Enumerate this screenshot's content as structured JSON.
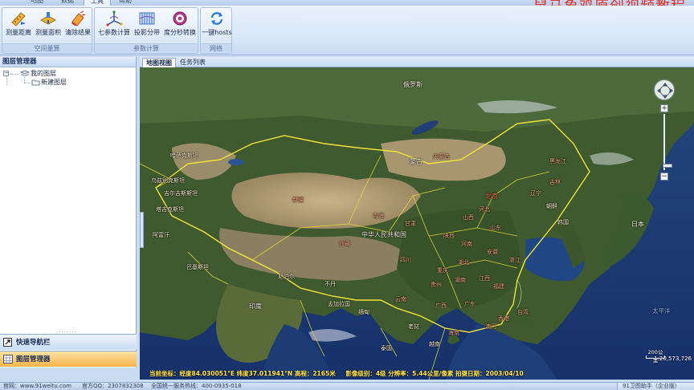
{
  "ribbon": {
    "tabs": [
      {
        "label": "地图"
      },
      {
        "label": "数据"
      },
      {
        "label": "工具",
        "active": true
      },
      {
        "label": "帮助"
      }
    ],
    "watermark": "鼠马象鸡原创视频教程",
    "groups": [
      {
        "label": "空间量算",
        "buttons": [
          {
            "label": "测量距离",
            "icon": "ruler-icon"
          },
          {
            "label": "测量面积",
            "icon": "area-icon"
          },
          {
            "label": "清除结果",
            "icon": "eraser-icon"
          }
        ]
      },
      {
        "label": "参数计算",
        "buttons": [
          {
            "label": "七参数计算",
            "icon": "axes-icon"
          },
          {
            "label": "投影分带",
            "icon": "projection-zones-icon"
          },
          {
            "label": "度分秒转换",
            "icon": "target-icon"
          }
        ]
      },
      {
        "label": "网络",
        "buttons": [
          {
            "label": "一键hosts",
            "icon": "refresh-icon"
          }
        ]
      }
    ]
  },
  "layer_manager": {
    "title": "图层管理器",
    "tree": [
      {
        "label": "我的图层",
        "expanded": true,
        "children": [
          {
            "label": "新建图层"
          }
        ]
      }
    ]
  },
  "accordion": {
    "quick_nav": "快速导航栏",
    "layer_manager": "图层管理器"
  },
  "map_tabs": [
    {
      "label": "地图视图",
      "active": true
    },
    {
      "label": "任务列表"
    }
  ],
  "map": {
    "status_text": "当前坐标：经度84.030051°E 纬度37.011941°N 高程：2165米",
    "image_info": "影像级别：4级 分辨率：5.44公里/像素 拍摄日期：2003/04/10",
    "scale_label": "200公里",
    "scale_ratio": "1:20,573,726",
    "labels": {
      "russia": "俄罗斯",
      "kazakhstan": "哈萨克斯坦",
      "mongolia": "蒙古",
      "inner_mongolia": "内蒙古",
      "heilongjiang": "黑龙江",
      "jilin": "吉林",
      "liaoning": "辽宁",
      "beijing": "北京",
      "xinjiang": "新疆",
      "china": "中华人民共和国",
      "tibet": "西藏",
      "qinghai": "青海",
      "gansu": "甘肃",
      "sichuan": "四川",
      "yunnan": "云南",
      "guangdong": "广东",
      "hunan": "湖南",
      "jiangxi": "江西",
      "shandong": "山东",
      "henan": "河南",
      "hubei": "湖北",
      "chongqing": "重庆",
      "guizhou": "贵州",
      "guangxi": "广西",
      "fujian": "福建",
      "zhejiang": "浙江",
      "hebei": "河北",
      "shanxi": "山西",
      "shaanxi": "陕西",
      "anhui": "安徽",
      "hainan": "海南",
      "taiwan": "台湾",
      "hongkong": "香港",
      "macau": "澳门",
      "korea": "朝鲜",
      "south_korea": "韩国",
      "japan": "日本",
      "india": "印度",
      "nepal": "尼泊尔",
      "pakistan": "巴基斯坦",
      "afghanistan": "阿富汗",
      "kyrgyz": "吉尔吉斯斯坦",
      "tajik": "塔吉克斯坦",
      "uzbek": "乌兹别克斯坦",
      "bhutan": "不丹",
      "bangladesh": "孟加拉国",
      "myanmar": "缅甸",
      "laos": "老挝",
      "vietnam": "越南",
      "thailand": "泰国",
      "pacific": "太平洋"
    }
  },
  "statusbar": {
    "website": "官网：www.91weitu.com",
    "qq": "官方QQ：2307832308",
    "hotline": "全国统一服务热线：400-0935-018",
    "product": "91卫图助手（企业版）"
  },
  "colors": {
    "ocean": "#1b3a72",
    "land_green": "#3e5a2e",
    "desert": "#b59f77",
    "border_yellow": "#f0e43a",
    "status_text": "#ffe347",
    "watermark": "#e0342c",
    "accordion_active": "#f6b44c"
  }
}
